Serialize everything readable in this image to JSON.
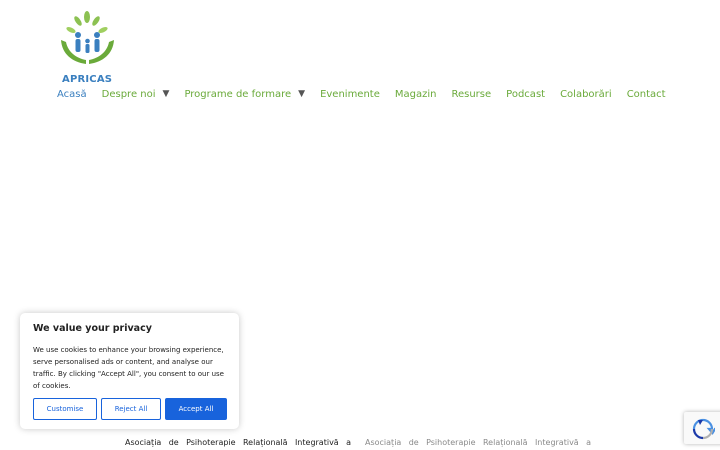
{
  "brand": {
    "logo_text": "APRICAS",
    "colors": {
      "green": "#6aaa3a",
      "blue": "#3a7fbf",
      "cookie_accent": "#1863dc"
    }
  },
  "nav": {
    "items": [
      {
        "label": "Acasă",
        "active": true,
        "dropdown": false
      },
      {
        "label": "Despre noi",
        "dropdown": true,
        "caret": "▼"
      },
      {
        "label": "Programe de formare",
        "dropdown": true,
        "caret": "▼"
      },
      {
        "label": "Evenimente"
      },
      {
        "label": "Magazin"
      },
      {
        "label": "Resurse"
      },
      {
        "label": "Podcast"
      },
      {
        "label": "Colaborări"
      },
      {
        "label": "Contact"
      }
    ]
  },
  "cookie_banner": {
    "title": "We value your privacy",
    "text": "We use cookies to enhance your browsing experience, serve personalised ads or content, and analyse our traffic. By clicking \"Accept All\", you consent to our use of cookies.",
    "buttons": {
      "customise": "Customise",
      "reject": "Reject All",
      "accept": "Accept All"
    }
  },
  "footer": {
    "left_text": "Asociația de Psihoterapie Relațională Integrativă a",
    "right_text": "Asociația de Psihoterapie Relațională Integrativă a"
  },
  "recaptcha": {
    "icon": "recaptcha-icon"
  }
}
